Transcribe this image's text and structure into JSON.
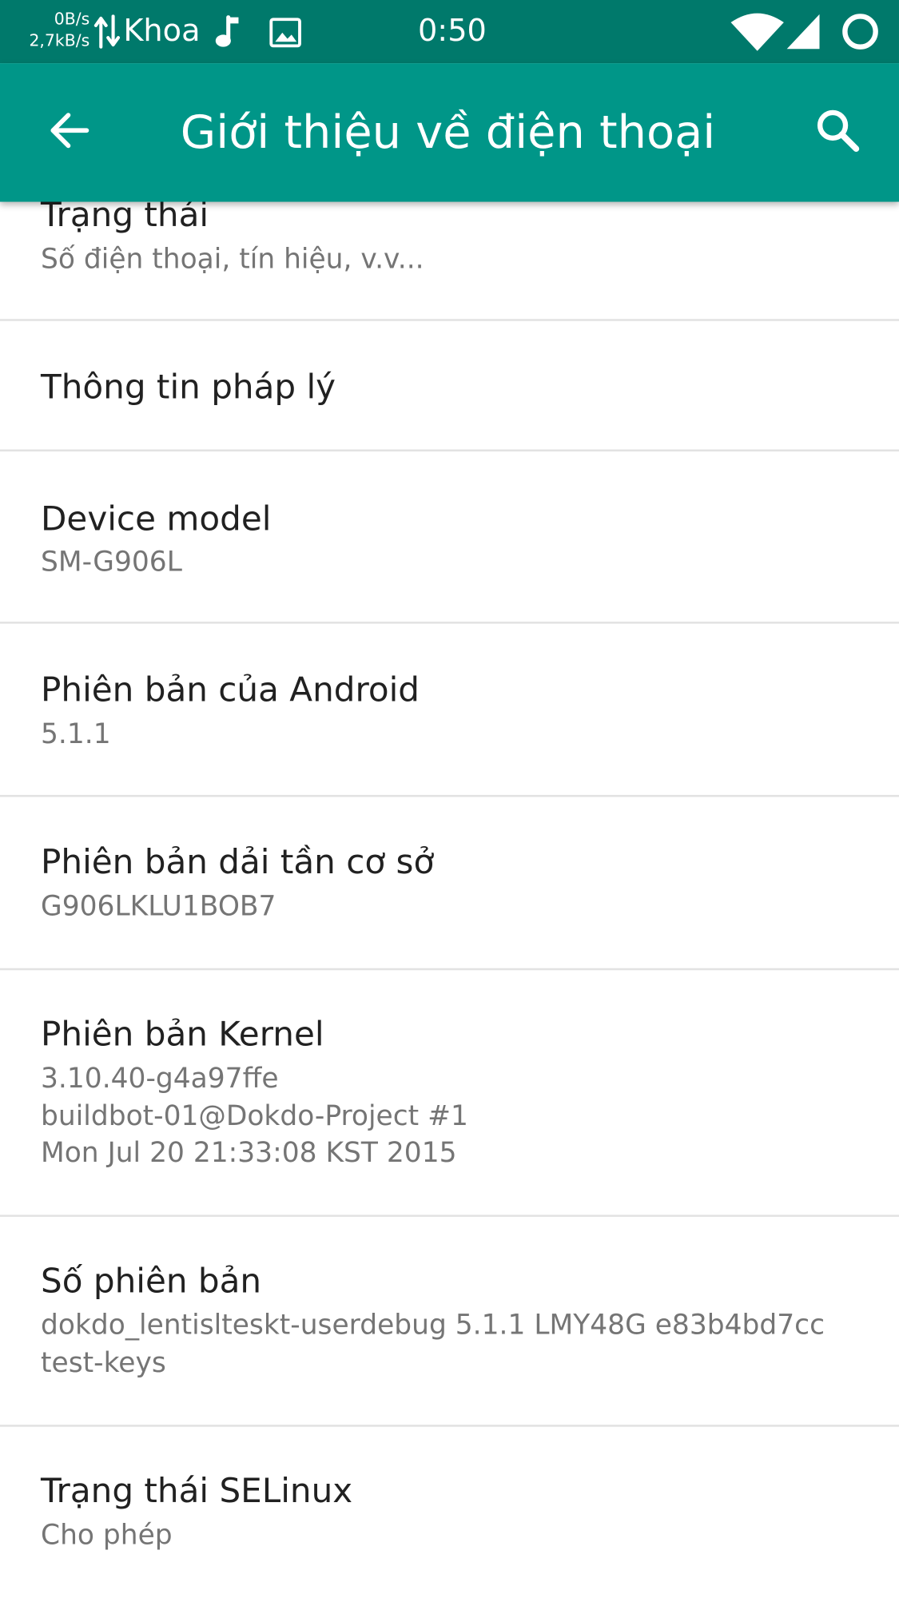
{
  "status_bar": {
    "net_speed_up": "0B/s",
    "net_speed_down": "2,7kB/s",
    "carrier": "Khoa",
    "time": "0:50",
    "icons": [
      "data-arrows-icon",
      "music-note-icon",
      "image-icon",
      "wifi-icon",
      "signal-icon",
      "battery-icon"
    ]
  },
  "app_bar": {
    "title": "Giới thiệu về điện thoại",
    "back_icon": "arrow-back-icon",
    "search_icon": "search-icon"
  },
  "items": [
    {
      "title": "Trạng thái",
      "summary": "Số điện thoại, tín hiệu, v.v..."
    },
    {
      "title": "Thông tin pháp lý"
    },
    {
      "title": "Device model",
      "summary": "SM-G906L"
    },
    {
      "title": "Phiên bản của Android",
      "summary": "5.1.1"
    },
    {
      "title": "Phiên bản dải tần cơ sở",
      "summary": "G906LKLU1BOB7"
    },
    {
      "title": "Phiên bản Kernel",
      "summary": "3.10.40-g4a97ffe\nbuildbot-01@Dokdo-Project #1\nMon Jul 20 21:33:08 KST 2015"
    },
    {
      "title": "Số phiên bản",
      "summary": "dokdo_lentislteskt-userdebug 5.1.1 LMY48G e83b4bd7cc\ntest-keys"
    },
    {
      "title": "Trạng thái SELinux",
      "summary": "Cho phép"
    }
  ],
  "colors": {
    "status_bar": "#00796b",
    "app_bar": "#009688",
    "primary_text": "#212121",
    "secondary_text": "#757575",
    "divider": "#e2e2e2"
  }
}
